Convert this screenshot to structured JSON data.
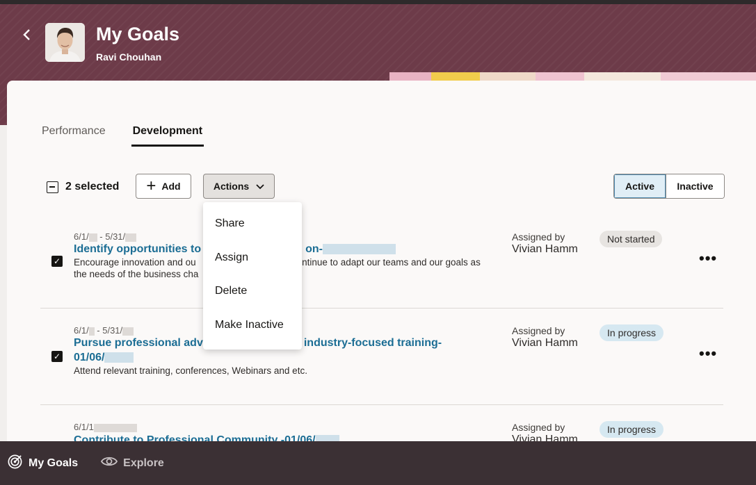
{
  "header": {
    "title": "My Goals",
    "subtitle": "Ravi Chouhan"
  },
  "tabs": [
    {
      "label": "Performance"
    },
    {
      "label": "Development"
    }
  ],
  "toolbar": {
    "selected_text": "2 selected",
    "add_label": "Add",
    "actions_label": "Actions"
  },
  "status_filter": {
    "active_label": "Active",
    "inactive_label": "Inactive"
  },
  "actions_menu": [
    "Share",
    "Assign",
    "Delete",
    "Make Inactive"
  ],
  "goals": [
    {
      "dates": "6/1/",
      "dates_mid": " - 5/31/",
      "title_start": "Identify opportunities to",
      "title_end": "on-",
      "desc_start": "Encourage innovation and ou",
      "desc_end": "ontinue to adapt our teams and our goals as",
      "desc_line2": "the needs of the business cha",
      "assigned_label": "Assigned by",
      "assigned_name": "Vivian Hamm",
      "status": "Not started"
    },
    {
      "dates": "6/1/",
      "dates_mid": " - 5/31/",
      "title_start": "Pursue professional adv",
      "title_end": "industry-focused training-",
      "title_line2": "01/06/",
      "desc": "Attend relevant training, conferences, Webinars and etc.",
      "assigned_label": "Assigned by",
      "assigned_name": "Vivian Hamm",
      "status": "In progress"
    },
    {
      "dates": "6/1/1",
      "title_start": "Contribute to Professional Community -01/06/",
      "assigned_label": "Assigned by",
      "assigned_name": "Vivian Hamm",
      "status": "In progress"
    }
  ],
  "footer": {
    "my_goals_label": "My Goals",
    "explore_label": "Explore"
  },
  "icons": {
    "back": "chevron-left-icon",
    "selection": "minus-square-icon",
    "add": "plus-icon",
    "actions": "chevron-down-icon",
    "row_check": "checkmark-icon",
    "row_more": "more-horizontal-icon",
    "footer_goals": "target-icon",
    "footer_explore": "eye-icon"
  },
  "colors": {
    "header_bg": "#6d3b49",
    "link": "#1b6d94",
    "footer_bg": "#3b3034"
  }
}
